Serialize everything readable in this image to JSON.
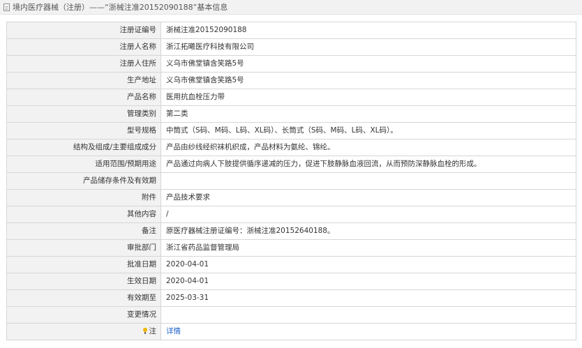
{
  "header": {
    "icon": "document-icon",
    "title": "境内医疗器械（注册）——“浙械注准20152090188”基本信息"
  },
  "rows": [
    {
      "label": "注册证编号",
      "value": "浙械注准20152090188"
    },
    {
      "label": "注册人名称",
      "value": "浙江拓曦医疗科技有限公司"
    },
    {
      "label": "注册人住所",
      "value": "义乌市佛堂镇含笑路5号"
    },
    {
      "label": "生产地址",
      "value": "义乌市佛堂镇含笑路5号"
    },
    {
      "label": "产品名称",
      "value": "医用抗血栓压力带"
    },
    {
      "label": "管理类别",
      "value": "第二类"
    },
    {
      "label": "型号规格",
      "value": "中筒式（S码、M码、L码、XL码）、长筒式（S码、M码、L码、XL码）。"
    },
    {
      "label": "结构及组成/主要组成成分",
      "value": "产品由纱线经织袜机织成，产品材料为氨纶、锦纶。"
    },
    {
      "label": "适用范围/预期用途",
      "value": "产品通过向病人下肢提供循序递减的压力，促进下肢静脉血液回流，从而预防深静脉血栓的形成。"
    },
    {
      "label": "产品储存条件及有效期",
      "value": ""
    },
    {
      "label": "附件",
      "value": "产品技术要求"
    },
    {
      "label": "其他内容",
      "value": "/"
    },
    {
      "label": "备注",
      "value": "原医疗器械注册证编号：浙械注准20152640188。"
    },
    {
      "label": "审批部门",
      "value": "浙江省药品监督管理局"
    },
    {
      "label": "批准日期",
      "value": "2020-04-01"
    },
    {
      "label": "生效日期",
      "value": "2020-04-01"
    },
    {
      "label": "有效期至",
      "value": "2025-03-31"
    },
    {
      "label": "变更情况",
      "value": ""
    }
  ],
  "note_row": {
    "icon": "lightbulb-icon",
    "label": "注",
    "link": "详情"
  }
}
